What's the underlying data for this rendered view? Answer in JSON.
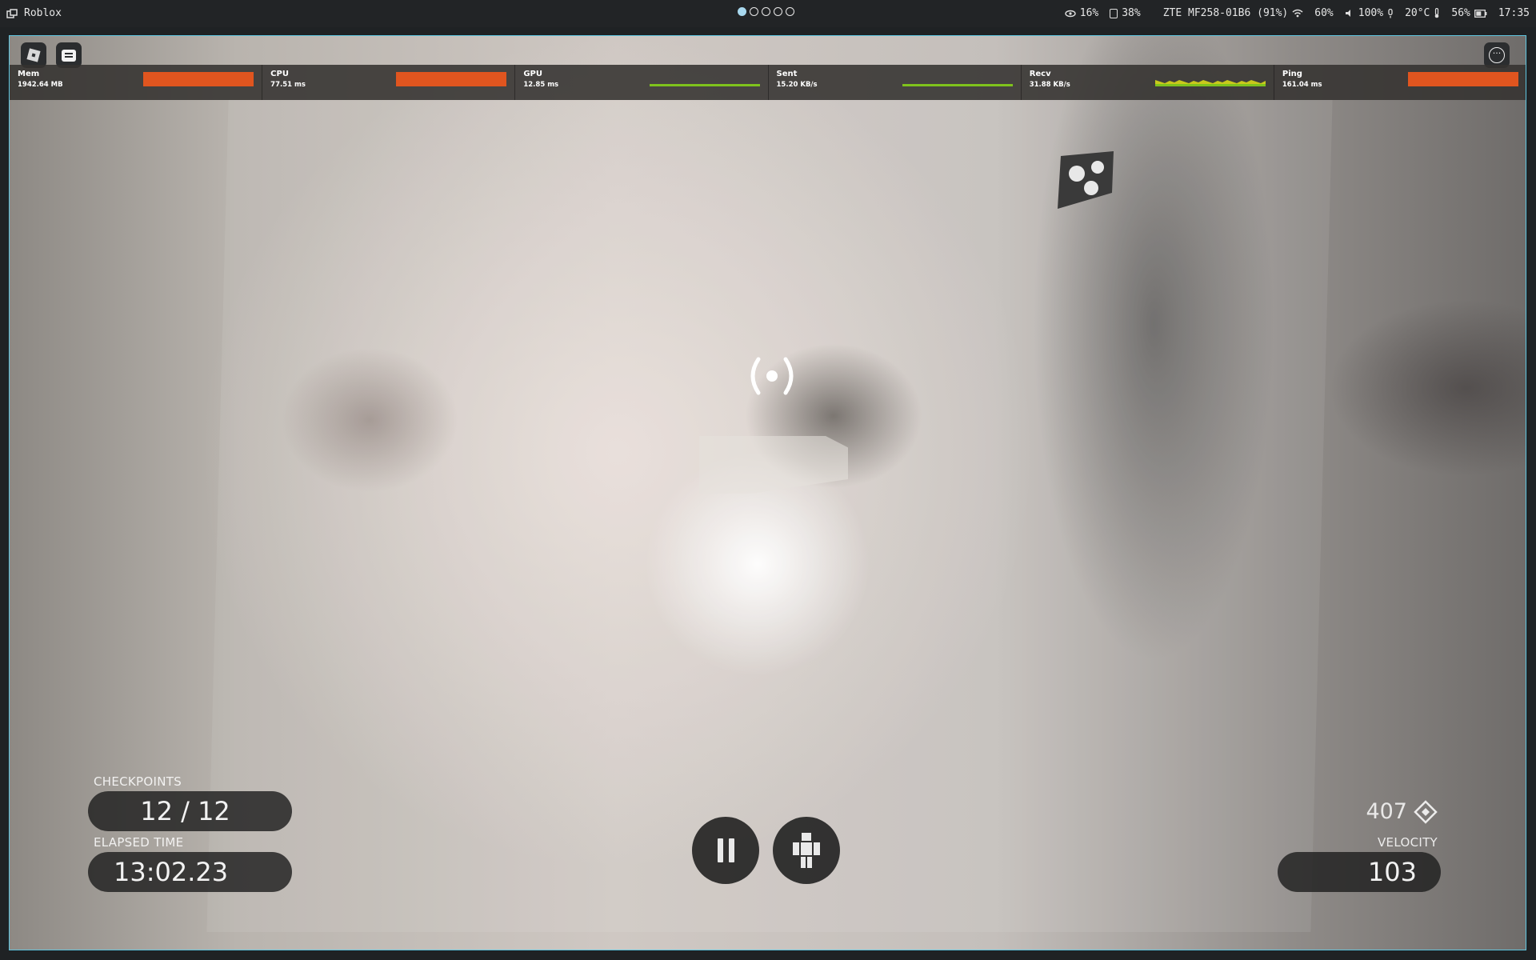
{
  "topbar": {
    "app_title": "Roblox",
    "workspaces": [
      true,
      false,
      false,
      false,
      false
    ],
    "status": [
      {
        "name": "eye-icon",
        "value": "16%"
      },
      {
        "name": "storage-icon",
        "value": "38%"
      },
      {
        "name": "wifi-icon",
        "value": "ZTE MF258-01B6 (91%)"
      },
      {
        "name": "brightness",
        "value": "60%"
      },
      {
        "name": "volume-icon",
        "value": "100%"
      },
      {
        "name": "temperature",
        "value": "20°C"
      },
      {
        "name": "battery-icon",
        "value": "56%"
      },
      {
        "name": "clock",
        "value": "17:35"
      }
    ]
  },
  "perf": [
    {
      "label": "Mem",
      "value": "1942.64 MB",
      "color": "#e0551f",
      "graph": "full"
    },
    {
      "label": "CPU",
      "value": "77.51 ms",
      "color": "#e0551f",
      "graph": "full"
    },
    {
      "label": "GPU",
      "value": "12.85 ms",
      "color": "#7fc31c",
      "graph": "flat"
    },
    {
      "label": "Sent",
      "value": "15.20 KB/s",
      "color": "#7fc31c",
      "graph": "flat"
    },
    {
      "label": "Recv",
      "value": "31.88 KB/s",
      "color": "#c8c81c",
      "graph": "partial"
    },
    {
      "label": "Ping",
      "value": "161.04 ms",
      "color": "#e0551f",
      "graph": "full"
    }
  ],
  "hud": {
    "checkpoints_label": "CHECKPOINTS",
    "checkpoints_value": "12 / 12",
    "elapsed_label": "ELAPSED TIME",
    "elapsed_value": "13:02.23",
    "gems": "407",
    "velocity_label": "VELOCITY",
    "velocity_value": "103"
  }
}
